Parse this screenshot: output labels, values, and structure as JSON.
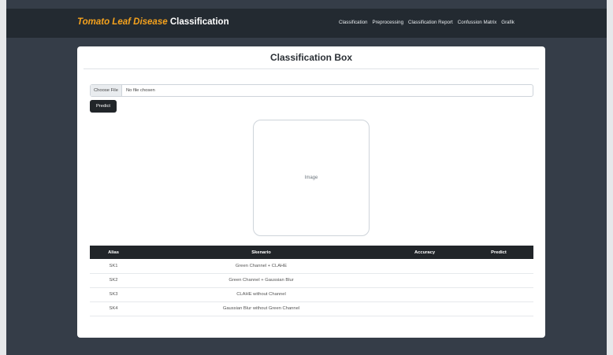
{
  "navbar": {
    "brand_highlight": "Tomato Leaf Disease",
    "brand_rest": "Classification",
    "links": [
      "Classification",
      "Preprocessing",
      "Classification Report",
      "Confussion Matrix",
      "Grafik"
    ]
  },
  "card": {
    "title": "Classification Box",
    "file_button_label": "Choose File",
    "file_status": "No file chosen",
    "predict_label": "Predict",
    "image_placeholder": "Image"
  },
  "table": {
    "headers": [
      "Alias",
      "Skenario",
      "Accuracy",
      "Predict"
    ],
    "rows": [
      {
        "alias": "SK1",
        "scenario": "Green Channel + CLAHE",
        "accuracy": "",
        "predict": ""
      },
      {
        "alias": "SK2",
        "scenario": "Green Channel + Gaussian Blur",
        "accuracy": "",
        "predict": ""
      },
      {
        "alias": "SK3",
        "scenario": "CLAHE without Channel",
        "accuracy": "",
        "predict": ""
      },
      {
        "alias": "SK4",
        "scenario": "Gaussian Blur without Green Channel",
        "accuracy": "",
        "predict": ""
      }
    ]
  },
  "colors": {
    "background": "#353d48",
    "navbar": "#232a31",
    "brand_accent": "#f5a21d",
    "button_dark": "#212529"
  }
}
